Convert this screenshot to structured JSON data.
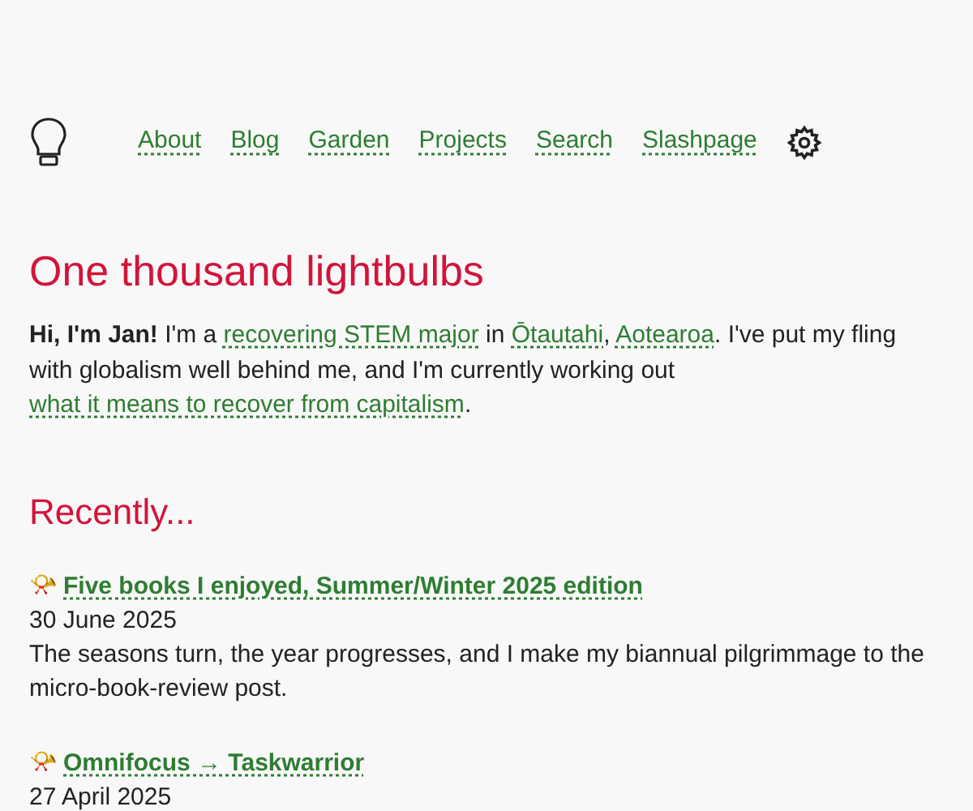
{
  "nav": [
    {
      "label": "About"
    },
    {
      "label": "Blog"
    },
    {
      "label": "Garden"
    },
    {
      "label": "Projects"
    },
    {
      "label": "Search"
    },
    {
      "label": "Slashpage"
    }
  ],
  "title": "One thousand lightbulbs",
  "intro": [
    {
      "kind": "text",
      "text": "**Hi, I'm Jan!** I'm a "
    },
    {
      "kind": "link",
      "text": "recovering STEM major"
    },
    {
      "kind": "text",
      "text": " in "
    },
    {
      "kind": "link",
      "text": "Ōtautahi"
    },
    {
      "kind": "text",
      "text": ", "
    },
    {
      "kind": "link",
      "text": "Aotearoa"
    },
    {
      "kind": "text",
      "text": ". I've put my fling with globalism well behind me, and I'm currently working out "
    },
    {
      "kind": "link",
      "text": "what it means to recover from capitalism"
    },
    {
      "kind": "text",
      "text": "."
    }
  ],
  "recent_heading": "Recently...",
  "posts": [
    {
      "emoji": "📯",
      "title": "Five books I enjoyed, Summer/Winter 2025 edition",
      "date": "30 June 2025",
      "summary": "The seasons turn, the year progresses, and I make my biannual pilgrimmage to the micro-book-review post."
    },
    {
      "emoji": "📯",
      "title": "Omnifocus → Taskwarrior",
      "date": "27 April 2025"
    }
  ]
}
